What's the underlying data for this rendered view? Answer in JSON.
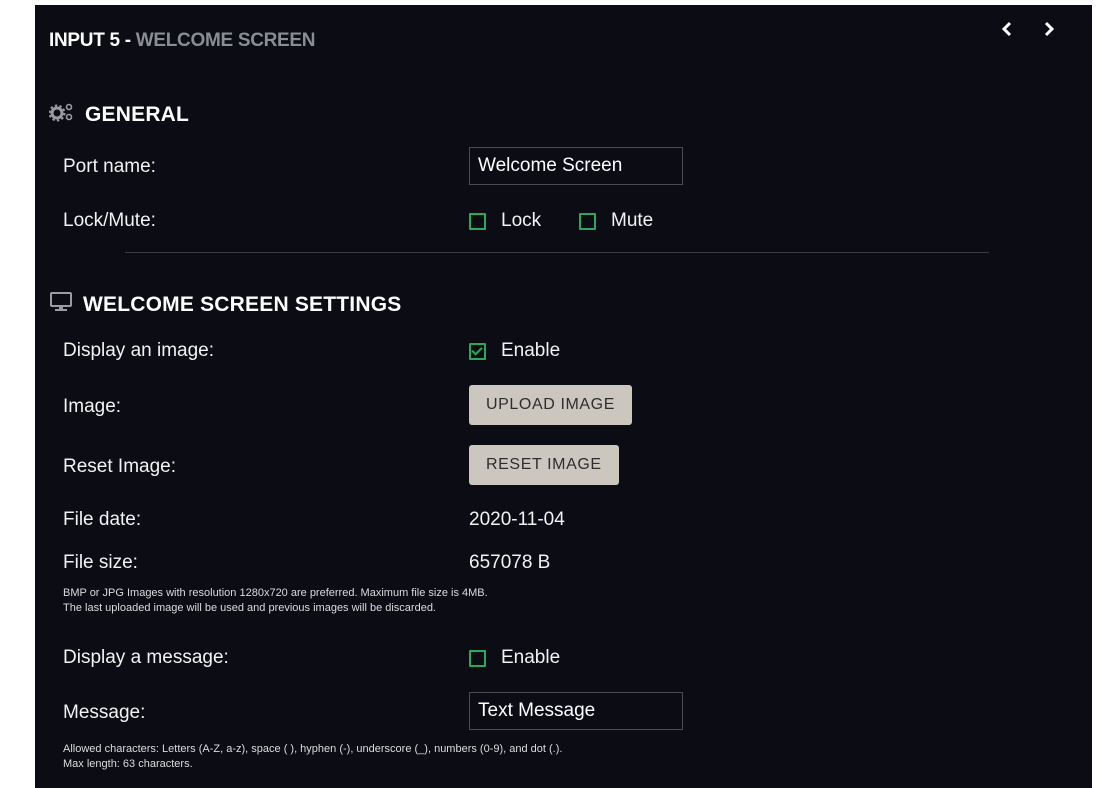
{
  "header": {
    "title_main": "INPUT 5 - ",
    "title_sub": "WELCOME SCREEN"
  },
  "nav": {
    "prev": "‹",
    "next": "›"
  },
  "general": {
    "title": "GENERAL",
    "port_name_label": "Port name:",
    "port_name_value": "Welcome Screen",
    "lock_mute_label": "Lock/Mute:",
    "lock_label": "Lock",
    "mute_label": "Mute"
  },
  "welcome": {
    "title": "WELCOME SCREEN SETTINGS",
    "display_image_label": "Display an image:",
    "display_image_enable": "Enable",
    "image_label": "Image:",
    "upload_button": "UPLOAD IMAGE",
    "reset_image_label": "Reset Image:",
    "reset_button": "RESET IMAGE",
    "file_date_label": "File date:",
    "file_date_value": "2020-11-04",
    "file_size_label": "File size:",
    "file_size_value": "657078 B",
    "image_note_1": "BMP or JPG Images with resolution 1280x720 are preferred. Maximum file size is 4MB.",
    "image_note_2": "The last uploaded image will be used and previous images will be discarded.",
    "display_message_label": "Display a message:",
    "display_message_enable": "Enable",
    "message_label": "Message:",
    "message_value": "Text Message",
    "message_note_1": "Allowed characters: Letters (A-Z, a-z), space ( ), hyphen (-), underscore (_), numbers (0-9), and dot (.).",
    "message_note_2": "Max length: 63 characters."
  },
  "state": {
    "lock_checked": false,
    "mute_checked": false,
    "display_image_checked": true,
    "display_message_checked": false
  },
  "colors": {
    "background": "#0b0c14",
    "accent_green": "#2aa85b",
    "button_bg": "#cbc6be",
    "subtitle_gray": "#8a8d96"
  },
  "icons": {
    "general": "gears-icon",
    "welcome": "monitor-icon",
    "prev": "chevron-left-icon",
    "next": "chevron-right-icon"
  }
}
